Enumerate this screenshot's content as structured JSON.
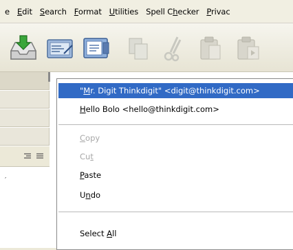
{
  "menubar": {
    "items": [
      {
        "pre": "",
        "ul": "",
        "post": "e"
      },
      {
        "pre": "",
        "ul": "E",
        "post": "dit"
      },
      {
        "pre": "",
        "ul": "S",
        "post": "earch"
      },
      {
        "pre": "",
        "ul": "F",
        "post": "ormat"
      },
      {
        "pre": "",
        "ul": "U",
        "post": "tilities"
      },
      {
        "pre": "Spell C",
        "ul": "h",
        "post": "ecker"
      },
      {
        "pre": "",
        "ul": "P",
        "post": "rivac"
      }
    ]
  },
  "toolbar": {
    "buttons": [
      "send-receive",
      "compose-envelope",
      "address-book",
      "copy-disabled",
      "cut-disabled",
      "paste-disabled",
      "paste-special-disabled"
    ]
  },
  "context_menu": {
    "items": [
      {
        "pre": "\"",
        "ul": "M",
        "post": "r. Digit Thinkdigit\" <digit@thinkdigit.com>",
        "state": "selected"
      },
      {
        "pre": "",
        "ul": "H",
        "post": "ello Bolo <hello@thinkdigit.com>",
        "state": "normal"
      },
      {
        "pre": "",
        "ul": "C",
        "post": "opy",
        "state": "disabled"
      },
      {
        "pre": "Cu",
        "ul": "t",
        "post": "",
        "state": "disabled"
      },
      {
        "pre": "",
        "ul": "P",
        "post": "aste",
        "state": "normal"
      },
      {
        "pre": "U",
        "ul": "n",
        "post": "do",
        "state": "normal"
      },
      {
        "pre": "Select ",
        "ul": "A",
        "post": "ll",
        "state": "normal"
      }
    ]
  },
  "colors": {
    "selection": "#316ac5",
    "menu_bg": "#ffffff",
    "disabled_text": "#a8a8a8"
  }
}
